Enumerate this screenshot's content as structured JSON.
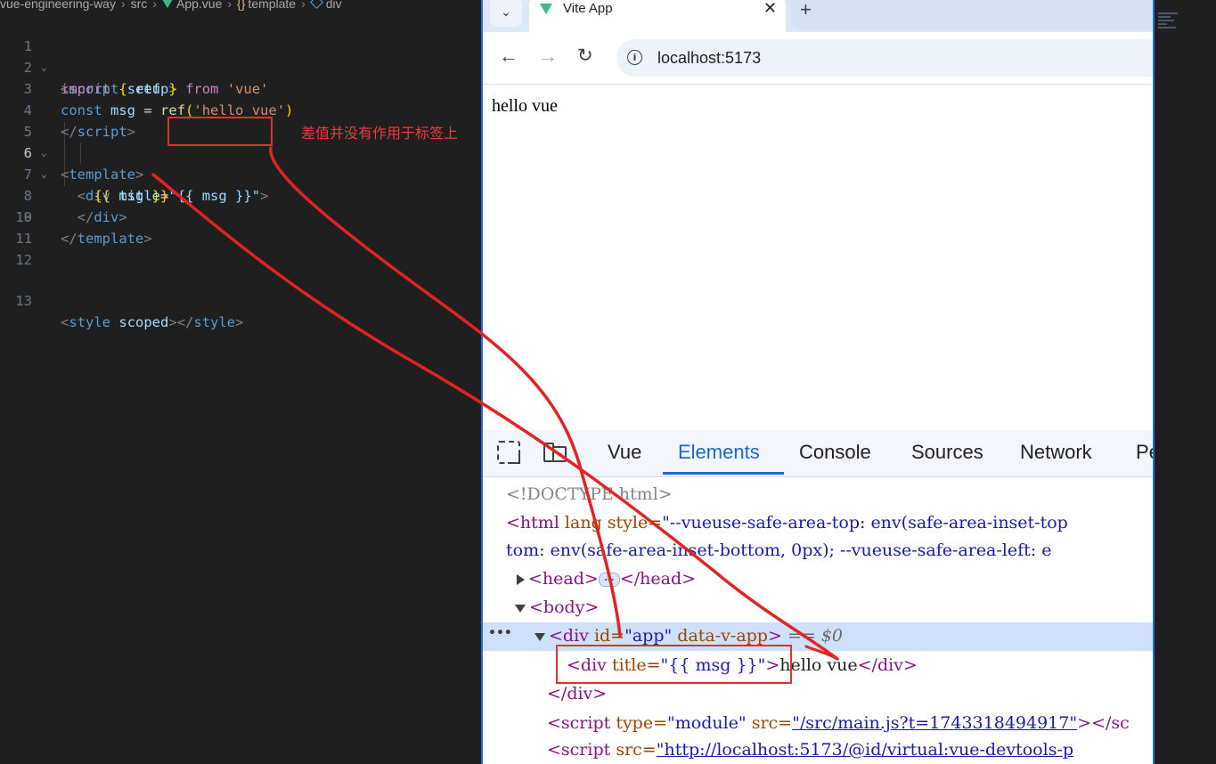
{
  "editor": {
    "breadcrumb": [
      "vue-engineering-way",
      "src",
      "App.vue",
      "template",
      "div"
    ],
    "lines": [
      {
        "n": "1"
      },
      {
        "n": "2"
      },
      {
        "n": "3"
      },
      {
        "n": "4"
      },
      {
        "n": "5"
      },
      {
        "n": "6"
      },
      {
        "n": "7"
      },
      {
        "n": "8"
      },
      {
        "n": "9"
      },
      {
        "n": "10"
      },
      {
        "n": "11"
      },
      {
        "n": "12"
      },
      {
        "n": "13"
      }
    ],
    "tokens": {
      "script_open": "script",
      "setup": "setup",
      "import": "import",
      "ref": "ref",
      "from": "from",
      "vue_str": "'vue'",
      "const": "const",
      "msg": "msg",
      "ref_fn": "ref",
      "hello_str": "'hello vue'",
      "script_close": "script",
      "template_open": "template",
      "div": "div",
      "title_attr": "title",
      "title_val": "\"{{ msg }}\"",
      "mustache_open": "{{",
      "mustache_var": "msg",
      "mustache_close": "}}",
      "div_close": "div",
      "template_close": "template",
      "style": "style",
      "scoped": "scoped",
      "style_close": "style"
    },
    "annotation": "差值并没有作用于标签上"
  },
  "browser": {
    "tab_title": "Vite App",
    "tab_close": "✕",
    "new_tab": "+",
    "url": "localhost:5173",
    "page_text": "hello vue",
    "devtools": {
      "tabs": [
        "Vue",
        "Elements",
        "Console",
        "Sources",
        "Network",
        "Pe"
      ],
      "active_tab": "Elements",
      "dom": {
        "doctype": "<!DOCTYPE html>",
        "html_line_1_tag": "<html",
        "html_line_1_attr": " lang style=",
        "html_line_1_val": "\"--vueuse-safe-area-top: env(safe-area-inset-top",
        "html_line_2_val": "tom: env(safe-area-inset-bottom, 0px); --vueuse-safe-area-left: e",
        "head_open": "<head>",
        "head_close": "</head>",
        "body_open": "<body>",
        "div_app_tag": "<div ",
        "div_app_attr1": "id=",
        "div_app_val1": "\"app\"",
        "div_app_attr2": " data-v-app",
        "div_app_end": ">",
        "div_app_dollar": " == $0",
        "inner_div_open": "<div ",
        "inner_div_attr": "title=",
        "inner_div_val": "\"{{ msg }}\"",
        "inner_div_end": ">",
        "inner_text": "hello vue",
        "inner_div_close": "</div>",
        "outer_div_close": "</div>",
        "script1_tag": "<script ",
        "script1_attr1": "type=",
        "script1_val1": "\"module\"",
        "script1_attr2": " src=",
        "script1_link": "\"/src/main.js?t=1743318494917\"",
        "script1_end": "></sc",
        "script2_tag": "<script ",
        "script2_attr": "src=",
        "script2_link": "\"http://localhost:5173/@id/virtual:vue-devtools-p"
      }
    }
  },
  "colors": {
    "annotation_red": "#e03030",
    "vue_green": "#41b883",
    "devtools_accent": "#1a66d6",
    "selected_row": "#cfe0fa"
  }
}
